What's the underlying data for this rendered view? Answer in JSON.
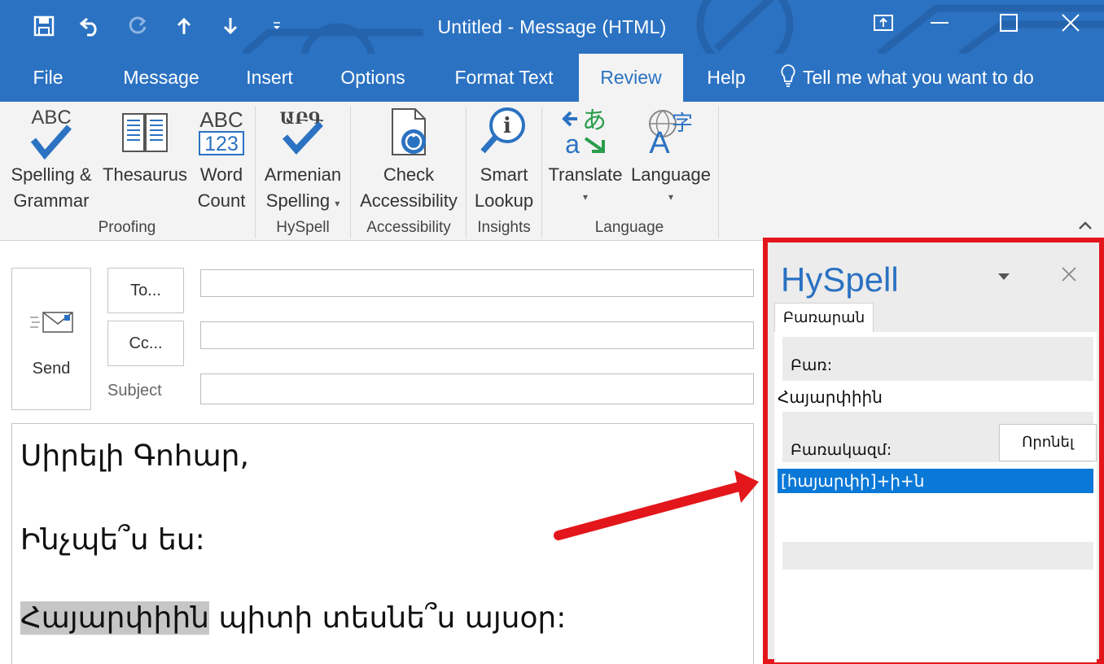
{
  "window": {
    "title": "Untitled  -  Message (HTML)"
  },
  "quick_access": [
    "save-icon",
    "undo-icon",
    "redo-icon",
    "up-arrow-icon",
    "down-arrow-icon",
    "customize-icon"
  ],
  "ribbon_tabs": [
    {
      "label": "File"
    },
    {
      "label": "Message"
    },
    {
      "label": "Insert"
    },
    {
      "label": "Options"
    },
    {
      "label": "Format Text"
    },
    {
      "label": "Review",
      "active": true
    },
    {
      "label": "Help"
    }
  ],
  "tell_me": "Tell me what you want to do",
  "ribbon": {
    "buttons": {
      "spelling": {
        "line1": "Spelling &",
        "line2": "Grammar",
        "icon_text": "ABC"
      },
      "thesaurus": {
        "line1": "Thesaurus"
      },
      "word_count": {
        "line1": "Word",
        "line2": "Count",
        "icon_top": "ABC",
        "icon_bottom": "123"
      },
      "armenian_spelling": {
        "line1": "Armenian",
        "line2": "Spelling",
        "icon_text": "ԱԲԳ"
      },
      "check_accessibility": {
        "line1": "Check",
        "line2": "Accessibility"
      },
      "smart_lookup": {
        "line1": "Smart",
        "line2": "Lookup"
      },
      "translate": {
        "line1": "Translate"
      },
      "language": {
        "line1": "Language"
      }
    },
    "groups": {
      "proofing": "Proofing",
      "hyspell": "HySpell",
      "accessibility": "Accessibility",
      "insights": "Insights",
      "language": "Language"
    }
  },
  "compose": {
    "send": "Send",
    "to": "To...",
    "cc": "Cc...",
    "subject": "Subject",
    "to_value": "",
    "cc_value": "",
    "subject_value": "",
    "body": {
      "line1": "Սիրելի Գոհար,",
      "line2": "Ինչպե՞ս ես:",
      "line3_highlight": "Հայարփիին",
      "line3_rest": " պիտի տեսնե՞ս այսօր:"
    }
  },
  "hyspell_pane": {
    "title": "HySpell",
    "tab": "Բառարան",
    "word_label": "Բառ:",
    "word_value": "Հայարփիին",
    "morph_label": "Բառակազմ:",
    "find_button": "Որոնել",
    "morph_result": "[հայարփի]+ի+ն"
  },
  "colors": {
    "title_bar": "#2b72c2",
    "ribbon_bg": "#f3f3f3",
    "highlight_border": "#e3161b",
    "selection": "#0a78d7"
  }
}
